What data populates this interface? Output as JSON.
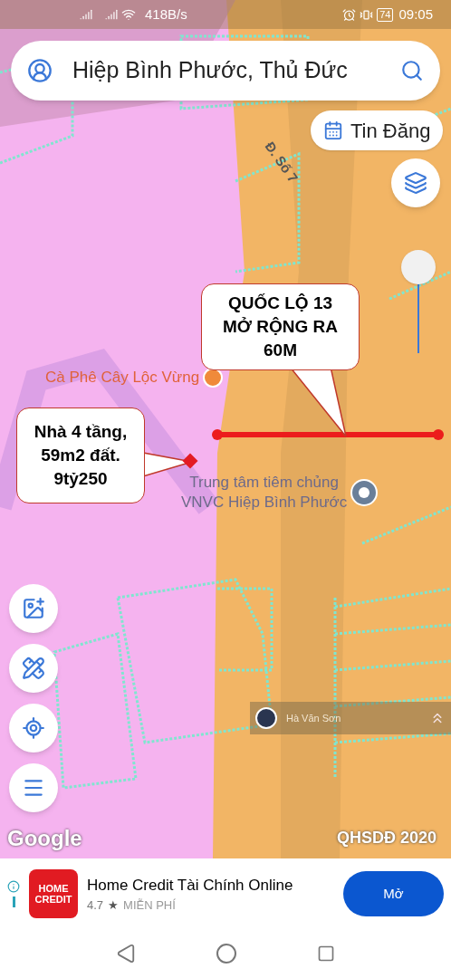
{
  "status_bar": {
    "speed": "418B/s",
    "battery": "74",
    "time": "09:05"
  },
  "search": {
    "value": "Hiệp Bình Phước, Thủ Đức"
  },
  "tin_dang": {
    "label": "Tin Đăng"
  },
  "zoom": {
    "level": 0.55
  },
  "map_labels": [
    {
      "kind": "street",
      "text": "Đ. Số 7"
    },
    {
      "kind": "poi",
      "text": "Cà Phê Cây Lộc Vừng"
    },
    {
      "kind": "place",
      "text": "Trung tâm tiêm chủng\nVNVC Hiệp Bình Phước"
    }
  ],
  "callouts": [
    {
      "text": "QUỐC LỘ 13\nMỞ RỘNG RA\n60M"
    },
    {
      "text": "Nhà 4 tầng,\n59m2 đất.\n9tỷ250"
    }
  ],
  "user_tag": {
    "name": "Hà Văn Sơn"
  },
  "attribution": "Google",
  "layer_name": "QHSDĐ 2020",
  "ad": {
    "logo": "HOME\nCREDIT",
    "title": "Home Credit Tài Chính Online",
    "rating": "4.7",
    "star": "★",
    "price": "MIỄN PHÍ",
    "button": "Mở"
  }
}
